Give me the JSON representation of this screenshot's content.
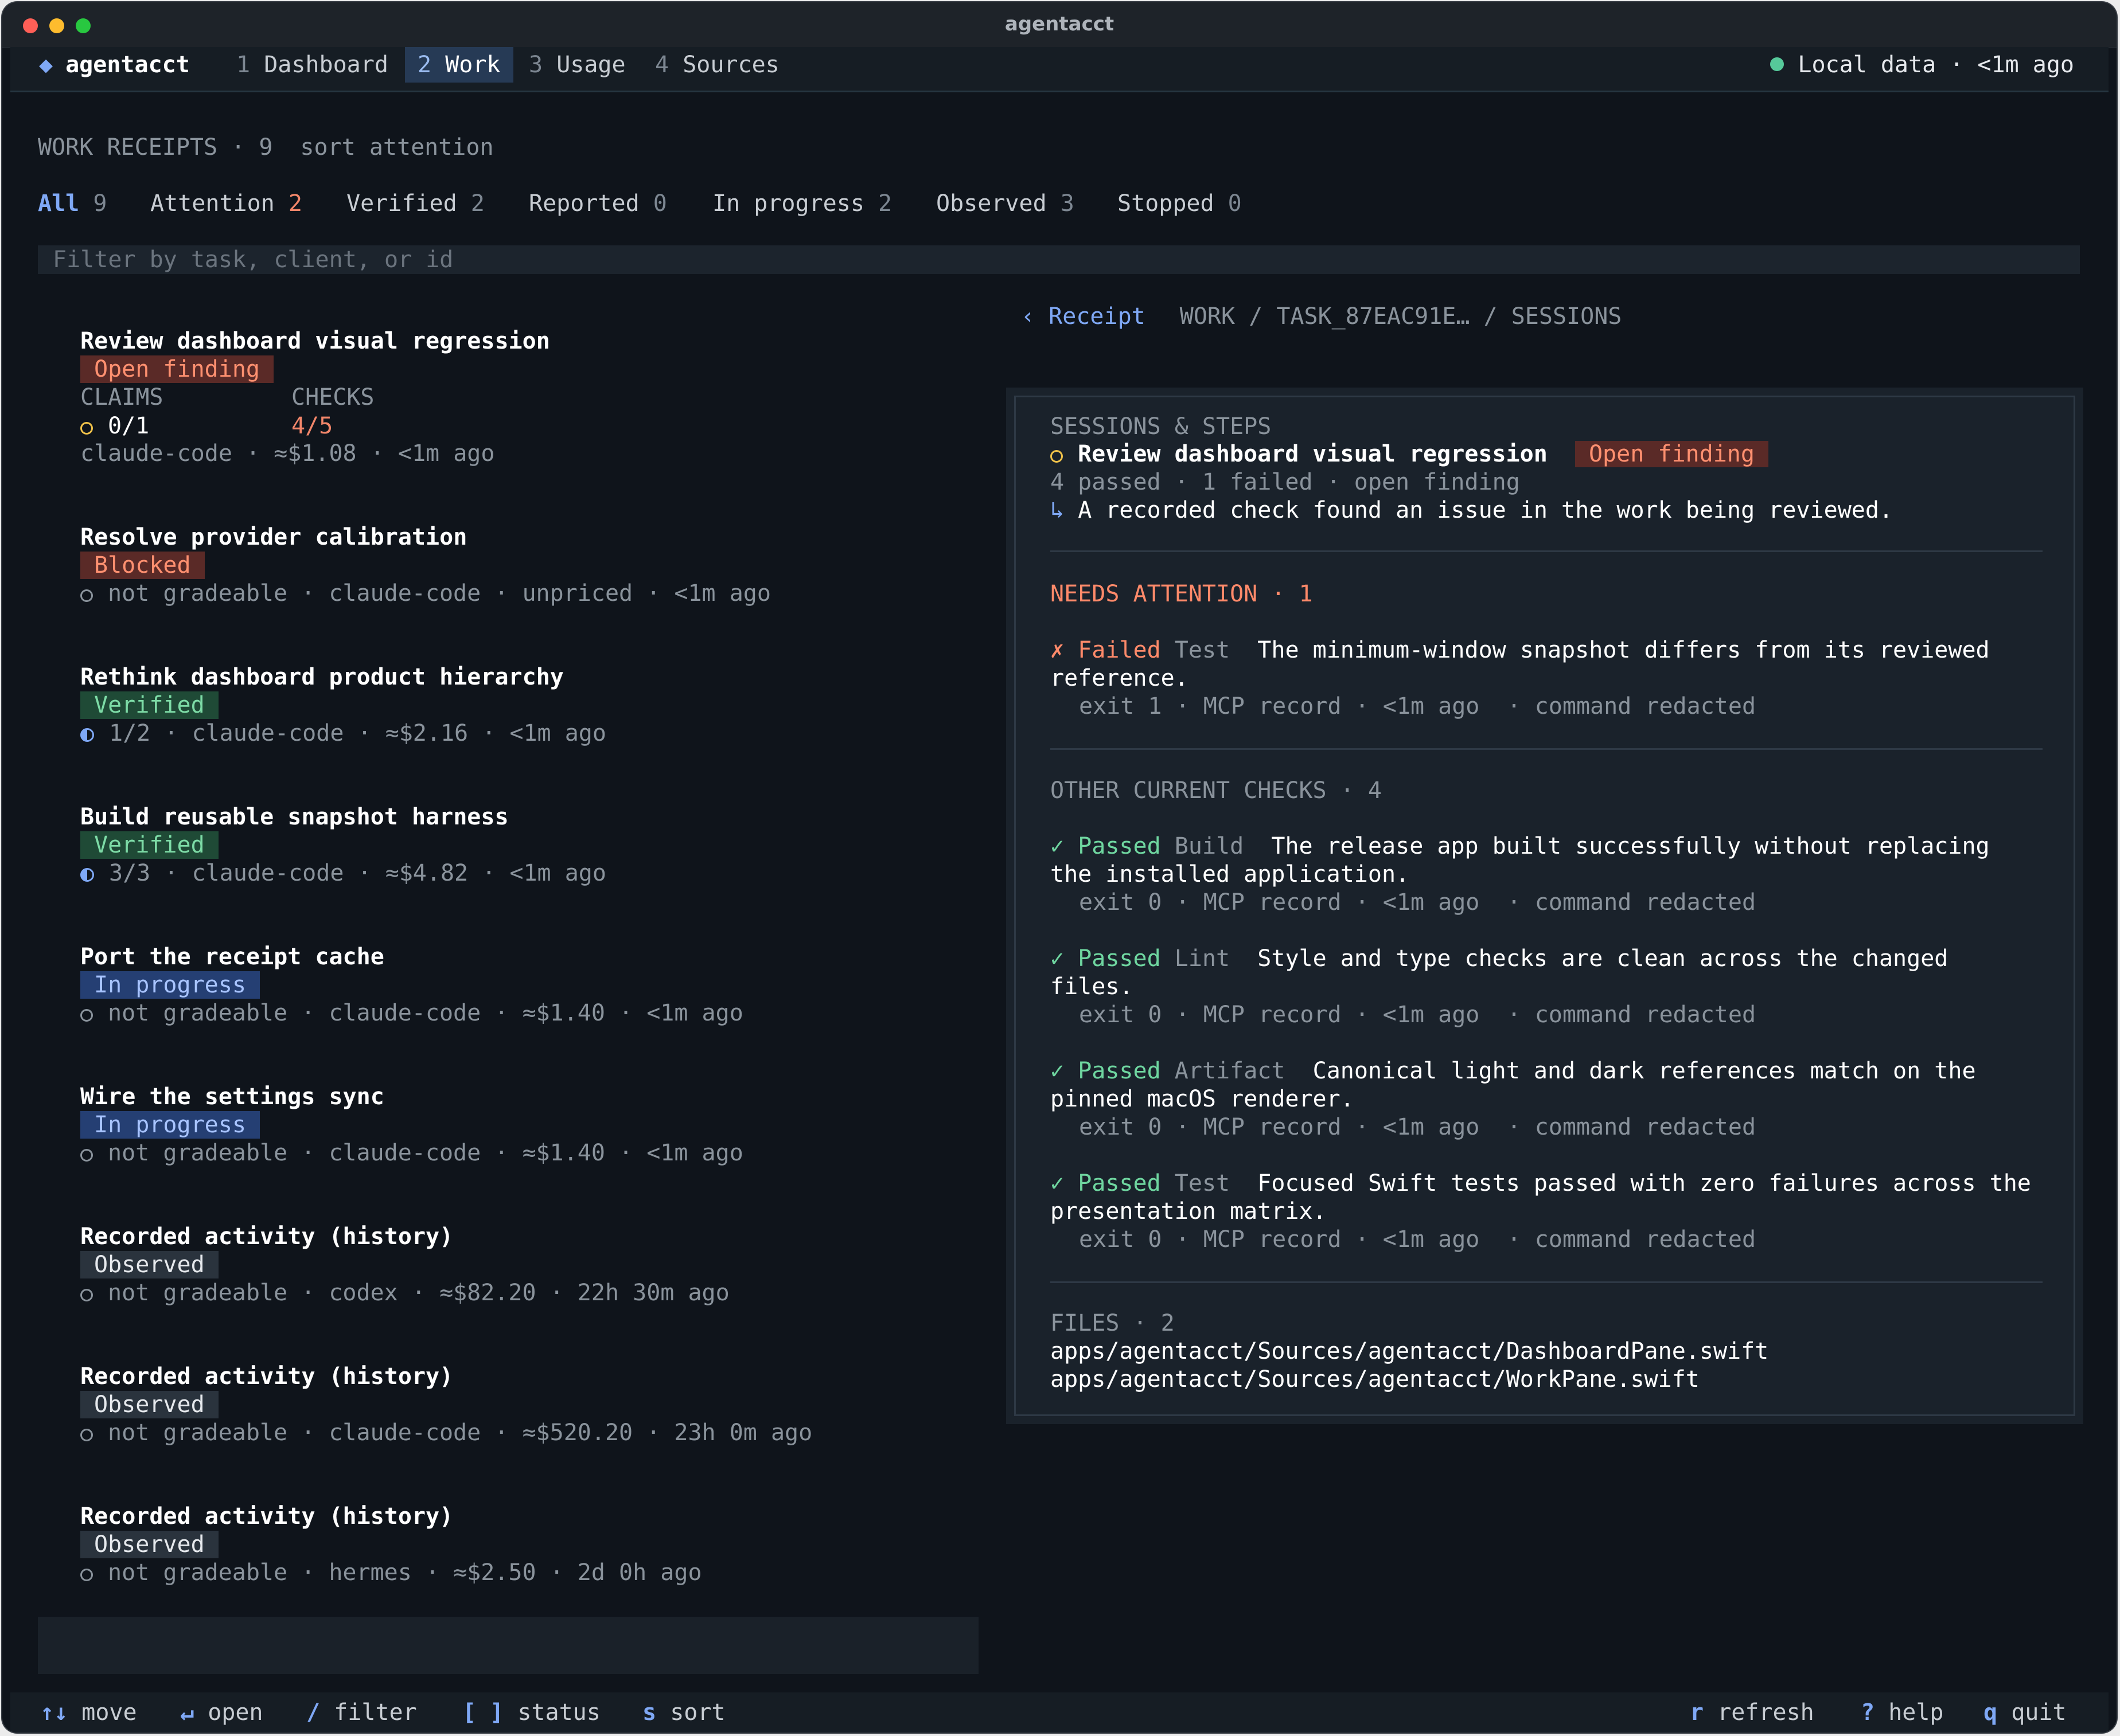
{
  "window": {
    "title": "agentacct"
  },
  "topnav": {
    "brand_icon": "diamond-icon",
    "brand": "agentacct",
    "tabs": [
      {
        "num": "1",
        "label": "Dashboard"
      },
      {
        "num": "2",
        "label": "Work"
      },
      {
        "num": "3",
        "label": "Usage"
      },
      {
        "num": "4",
        "label": "Sources"
      }
    ],
    "active_tab": 1,
    "status": "Local data · <1m ago"
  },
  "work": {
    "heading": "WORK RECEIPTS · 9",
    "sort": "sort attention",
    "filters": [
      {
        "label": "All",
        "count": "9"
      },
      {
        "label": "Attention",
        "count": "2"
      },
      {
        "label": "Verified",
        "count": "2"
      },
      {
        "label": "Reported",
        "count": "0"
      },
      {
        "label": "In progress",
        "count": "2"
      },
      {
        "label": "Observed",
        "count": "3"
      },
      {
        "label": "Stopped",
        "count": "0"
      }
    ],
    "filter_placeholder": "Filter by task, client, or id",
    "items": [
      {
        "title": "Review dashboard visual regression",
        "badge": "Open finding",
        "claims_label": "CLAIMS",
        "checks_label": "CHECKS",
        "claims": "0/1",
        "checks": "4/5",
        "meta": "claude-code · ≈$1.08 · <1m ago"
      },
      {
        "title": "Resolve provider calibration",
        "badge": "Blocked",
        "meta": "not gradeable · claude-code · unpriced · <1m ago"
      },
      {
        "title": "Rethink dashboard product hierarchy",
        "badge": "Verified",
        "meta": "1/2 · claude-code · ≈$2.16 · <1m ago"
      },
      {
        "title": "Build reusable snapshot harness",
        "badge": "Verified",
        "meta": "3/3 · claude-code · ≈$4.82 · <1m ago"
      },
      {
        "title": "Port the receipt cache",
        "badge": "In progress",
        "meta": "not gradeable · claude-code · ≈$1.40 · <1m ago"
      },
      {
        "title": "Wire the settings sync",
        "badge": "In progress",
        "meta": "not gradeable · claude-code · ≈$1.40 · <1m ago"
      },
      {
        "title": "Recorded activity (history)",
        "badge": "Observed",
        "meta": "not gradeable · codex · ≈$82.20 · 22h 30m ago"
      },
      {
        "title": "Recorded activity (history)",
        "badge": "Observed",
        "meta": "not gradeable · claude-code · ≈$520.20 · 23h 0m ago"
      },
      {
        "title": "Recorded activity (history)",
        "badge": "Observed",
        "meta": "not gradeable · hermes · ≈$2.50 · 2d 0h ago"
      }
    ]
  },
  "detail": {
    "back": "‹ Receipt",
    "path": "WORK / TASK_87EAC91E… / SESSIONS",
    "sessions_heading": "SESSIONS & STEPS",
    "session_title": "Review dashboard visual regression",
    "session_badge": "Open finding",
    "session_summary": "4 passed · 1 failed · open finding",
    "session_note_icon": "↳",
    "session_note": "A recorded check found an issue in the work being reviewed.",
    "attention_heading": "NEEDS ATTENTION · 1",
    "attention": [
      {
        "mark": "✗",
        "status": "Failed",
        "kind": "Test",
        "desc1": "The minimum-window snapshot differs from its reviewed",
        "desc2": "reference.",
        "meta": "exit 1 · MCP record · <1m ago  · command redacted"
      }
    ],
    "other_heading": "OTHER CURRENT CHECKS · 4",
    "checks": [
      {
        "mark": "✓",
        "status": "Passed",
        "kind": "Build",
        "desc1": "The release app built successfully without replacing",
        "desc2": "the installed application.",
        "meta": "exit 0 · MCP record · <1m ago  · command redacted"
      },
      {
        "mark": "✓",
        "status": "Passed",
        "kind": "Lint",
        "desc1": "Style and type checks are clean across the changed",
        "desc2": "files.",
        "meta": "exit 0 · MCP record · <1m ago  · command redacted"
      },
      {
        "mark": "✓",
        "status": "Passed",
        "kind": "Artifact",
        "desc1": "Canonical light and dark references match on the",
        "desc2": "pinned macOS renderer.",
        "meta": "exit 0 · MCP record · <1m ago  · command redacted"
      },
      {
        "mark": "✓",
        "status": "Passed",
        "kind": "Test",
        "desc1": "Focused Swift tests passed with zero failures across the",
        "desc2": "presentation matrix.",
        "meta": "exit 0 · MCP record · <1m ago  · command redacted"
      }
    ],
    "files_heading": "FILES · 2",
    "files": [
      "apps/agentacct/Sources/agentacct/DashboardPane.swift",
      "apps/agentacct/Sources/agentacct/WorkPane.swift"
    ]
  },
  "footer": {
    "keys": [
      {
        "key": "↑↓",
        "label": "move"
      },
      {
        "key": "↵",
        "label": "open"
      },
      {
        "key": "/",
        "label": "filter"
      },
      {
        "key": "[ ]",
        "label": "status"
      },
      {
        "key": "s",
        "label": "sort"
      }
    ],
    "right_keys": [
      {
        "key": "r",
        "label": "refresh"
      },
      {
        "key": "?",
        "label": "help"
      },
      {
        "key": "q",
        "label": "quit"
      }
    ]
  },
  "colors": {
    "background": "#0f141b",
    "accent": "#7fa8f5",
    "danger": "#ff8a6a",
    "success": "#6fd6a0",
    "progress": "#253f73"
  }
}
